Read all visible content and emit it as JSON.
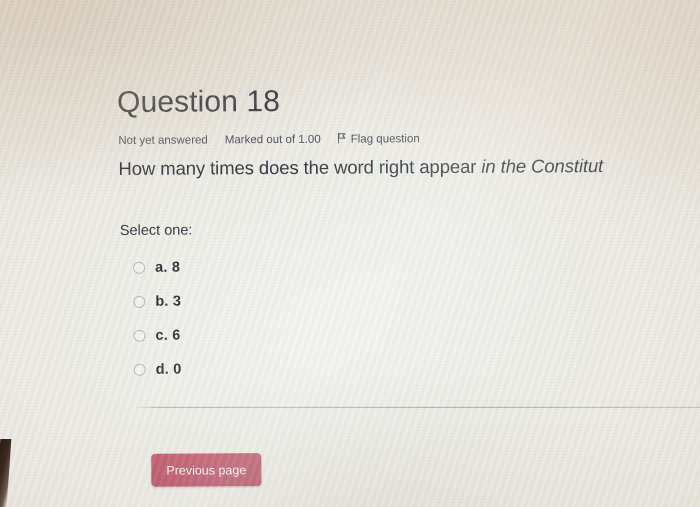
{
  "question": {
    "title": "Question 18",
    "status": "Not yet answered",
    "marks": "Marked out of 1.00",
    "flag_label": "Flag question",
    "flag_icon": "flag-icon",
    "text_plain": "How many times does the word right appear ",
    "text_italic": "in the Constitut",
    "full_text": "How many times does the word right appear in the Constitut",
    "select_prompt": "Select one:",
    "options": [
      {
        "letter": "a.",
        "value": "8",
        "label": "a. 8",
        "selected": false
      },
      {
        "letter": "b.",
        "value": "3",
        "label": "b. 3",
        "selected": false
      },
      {
        "letter": "c.",
        "value": "6",
        "label": "c. 6",
        "selected": false
      },
      {
        "letter": "d.",
        "value": "0",
        "label": "d. 0",
        "selected": false
      }
    ]
  },
  "navigation": {
    "previous_page_label": "Previous page"
  },
  "colors": {
    "button_red": "#b7415a",
    "title_text": "#2e3039",
    "body_text": "#343843",
    "meta_text": "#4a4e57",
    "divider": "#ac8e8e",
    "radio_border": "#b9bbbd",
    "page_background": "#eff0ea"
  }
}
